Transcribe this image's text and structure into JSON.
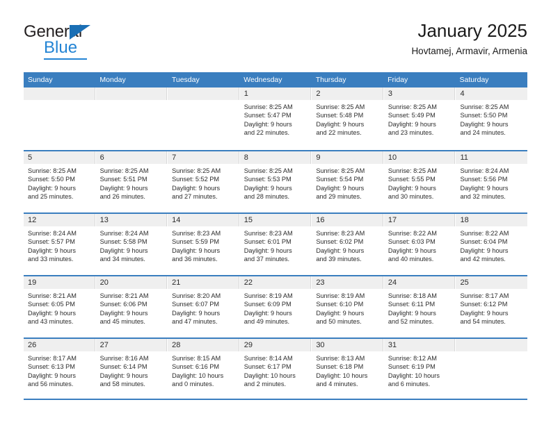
{
  "brand": {
    "name_top": "General",
    "name_bottom": "Blue",
    "accent_dark": "#1a6fb5",
    "accent_light": "#2384d4"
  },
  "header": {
    "title": "January 2025",
    "subtitle": "Hovtamej, Armavir, Armenia"
  },
  "calendar": {
    "header_bg": "#3a7ebf",
    "day_band_bg": "#efefef",
    "weekdays": [
      "Sunday",
      "Monday",
      "Tuesday",
      "Wednesday",
      "Thursday",
      "Friday",
      "Saturday"
    ],
    "weeks": [
      [
        {
          "day": "",
          "sunrise": "",
          "sunset": "",
          "daylight_1": "",
          "daylight_2": ""
        },
        {
          "day": "",
          "sunrise": "",
          "sunset": "",
          "daylight_1": "",
          "daylight_2": ""
        },
        {
          "day": "",
          "sunrise": "",
          "sunset": "",
          "daylight_1": "",
          "daylight_2": ""
        },
        {
          "day": "1",
          "sunrise": "Sunrise: 8:25 AM",
          "sunset": "Sunset: 5:47 PM",
          "daylight_1": "Daylight: 9 hours",
          "daylight_2": "and 22 minutes."
        },
        {
          "day": "2",
          "sunrise": "Sunrise: 8:25 AM",
          "sunset": "Sunset: 5:48 PM",
          "daylight_1": "Daylight: 9 hours",
          "daylight_2": "and 22 minutes."
        },
        {
          "day": "3",
          "sunrise": "Sunrise: 8:25 AM",
          "sunset": "Sunset: 5:49 PM",
          "daylight_1": "Daylight: 9 hours",
          "daylight_2": "and 23 minutes."
        },
        {
          "day": "4",
          "sunrise": "Sunrise: 8:25 AM",
          "sunset": "Sunset: 5:50 PM",
          "daylight_1": "Daylight: 9 hours",
          "daylight_2": "and 24 minutes."
        }
      ],
      [
        {
          "day": "5",
          "sunrise": "Sunrise: 8:25 AM",
          "sunset": "Sunset: 5:50 PM",
          "daylight_1": "Daylight: 9 hours",
          "daylight_2": "and 25 minutes."
        },
        {
          "day": "6",
          "sunrise": "Sunrise: 8:25 AM",
          "sunset": "Sunset: 5:51 PM",
          "daylight_1": "Daylight: 9 hours",
          "daylight_2": "and 26 minutes."
        },
        {
          "day": "7",
          "sunrise": "Sunrise: 8:25 AM",
          "sunset": "Sunset: 5:52 PM",
          "daylight_1": "Daylight: 9 hours",
          "daylight_2": "and 27 minutes."
        },
        {
          "day": "8",
          "sunrise": "Sunrise: 8:25 AM",
          "sunset": "Sunset: 5:53 PM",
          "daylight_1": "Daylight: 9 hours",
          "daylight_2": "and 28 minutes."
        },
        {
          "day": "9",
          "sunrise": "Sunrise: 8:25 AM",
          "sunset": "Sunset: 5:54 PM",
          "daylight_1": "Daylight: 9 hours",
          "daylight_2": "and 29 minutes."
        },
        {
          "day": "10",
          "sunrise": "Sunrise: 8:25 AM",
          "sunset": "Sunset: 5:55 PM",
          "daylight_1": "Daylight: 9 hours",
          "daylight_2": "and 30 minutes."
        },
        {
          "day": "11",
          "sunrise": "Sunrise: 8:24 AM",
          "sunset": "Sunset: 5:56 PM",
          "daylight_1": "Daylight: 9 hours",
          "daylight_2": "and 32 minutes."
        }
      ],
      [
        {
          "day": "12",
          "sunrise": "Sunrise: 8:24 AM",
          "sunset": "Sunset: 5:57 PM",
          "daylight_1": "Daylight: 9 hours",
          "daylight_2": "and 33 minutes."
        },
        {
          "day": "13",
          "sunrise": "Sunrise: 8:24 AM",
          "sunset": "Sunset: 5:58 PM",
          "daylight_1": "Daylight: 9 hours",
          "daylight_2": "and 34 minutes."
        },
        {
          "day": "14",
          "sunrise": "Sunrise: 8:23 AM",
          "sunset": "Sunset: 5:59 PM",
          "daylight_1": "Daylight: 9 hours",
          "daylight_2": "and 36 minutes."
        },
        {
          "day": "15",
          "sunrise": "Sunrise: 8:23 AM",
          "sunset": "Sunset: 6:01 PM",
          "daylight_1": "Daylight: 9 hours",
          "daylight_2": "and 37 minutes."
        },
        {
          "day": "16",
          "sunrise": "Sunrise: 8:23 AM",
          "sunset": "Sunset: 6:02 PM",
          "daylight_1": "Daylight: 9 hours",
          "daylight_2": "and 39 minutes."
        },
        {
          "day": "17",
          "sunrise": "Sunrise: 8:22 AM",
          "sunset": "Sunset: 6:03 PM",
          "daylight_1": "Daylight: 9 hours",
          "daylight_2": "and 40 minutes."
        },
        {
          "day": "18",
          "sunrise": "Sunrise: 8:22 AM",
          "sunset": "Sunset: 6:04 PM",
          "daylight_1": "Daylight: 9 hours",
          "daylight_2": "and 42 minutes."
        }
      ],
      [
        {
          "day": "19",
          "sunrise": "Sunrise: 8:21 AM",
          "sunset": "Sunset: 6:05 PM",
          "daylight_1": "Daylight: 9 hours",
          "daylight_2": "and 43 minutes."
        },
        {
          "day": "20",
          "sunrise": "Sunrise: 8:21 AM",
          "sunset": "Sunset: 6:06 PM",
          "daylight_1": "Daylight: 9 hours",
          "daylight_2": "and 45 minutes."
        },
        {
          "day": "21",
          "sunrise": "Sunrise: 8:20 AM",
          "sunset": "Sunset: 6:07 PM",
          "daylight_1": "Daylight: 9 hours",
          "daylight_2": "and 47 minutes."
        },
        {
          "day": "22",
          "sunrise": "Sunrise: 8:19 AM",
          "sunset": "Sunset: 6:09 PM",
          "daylight_1": "Daylight: 9 hours",
          "daylight_2": "and 49 minutes."
        },
        {
          "day": "23",
          "sunrise": "Sunrise: 8:19 AM",
          "sunset": "Sunset: 6:10 PM",
          "daylight_1": "Daylight: 9 hours",
          "daylight_2": "and 50 minutes."
        },
        {
          "day": "24",
          "sunrise": "Sunrise: 8:18 AM",
          "sunset": "Sunset: 6:11 PM",
          "daylight_1": "Daylight: 9 hours",
          "daylight_2": "and 52 minutes."
        },
        {
          "day": "25",
          "sunrise": "Sunrise: 8:17 AM",
          "sunset": "Sunset: 6:12 PM",
          "daylight_1": "Daylight: 9 hours",
          "daylight_2": "and 54 minutes."
        }
      ],
      [
        {
          "day": "26",
          "sunrise": "Sunrise: 8:17 AM",
          "sunset": "Sunset: 6:13 PM",
          "daylight_1": "Daylight: 9 hours",
          "daylight_2": "and 56 minutes."
        },
        {
          "day": "27",
          "sunrise": "Sunrise: 8:16 AM",
          "sunset": "Sunset: 6:14 PM",
          "daylight_1": "Daylight: 9 hours",
          "daylight_2": "and 58 minutes."
        },
        {
          "day": "28",
          "sunrise": "Sunrise: 8:15 AM",
          "sunset": "Sunset: 6:16 PM",
          "daylight_1": "Daylight: 10 hours",
          "daylight_2": "and 0 minutes."
        },
        {
          "day": "29",
          "sunrise": "Sunrise: 8:14 AM",
          "sunset": "Sunset: 6:17 PM",
          "daylight_1": "Daylight: 10 hours",
          "daylight_2": "and 2 minutes."
        },
        {
          "day": "30",
          "sunrise": "Sunrise: 8:13 AM",
          "sunset": "Sunset: 6:18 PM",
          "daylight_1": "Daylight: 10 hours",
          "daylight_2": "and 4 minutes."
        },
        {
          "day": "31",
          "sunrise": "Sunrise: 8:12 AM",
          "sunset": "Sunset: 6:19 PM",
          "daylight_1": "Daylight: 10 hours",
          "daylight_2": "and 6 minutes."
        },
        {
          "day": "",
          "sunrise": "",
          "sunset": "",
          "daylight_1": "",
          "daylight_2": ""
        }
      ]
    ]
  }
}
